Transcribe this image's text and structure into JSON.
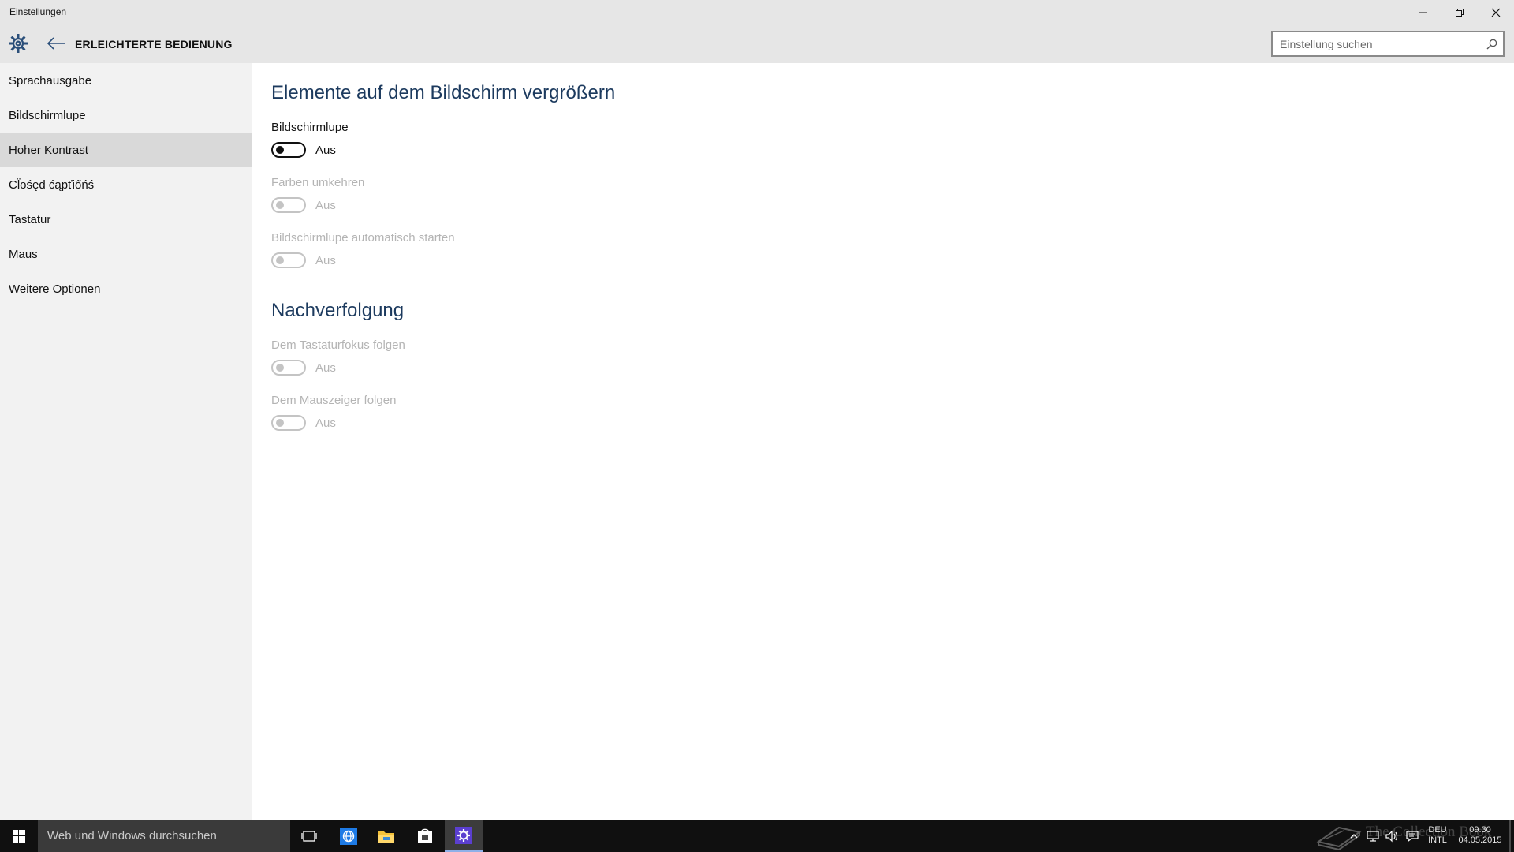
{
  "window": {
    "title": "Einstellungen",
    "section_title": "ERLEICHTERTE BEDIENUNG",
    "controls": {
      "minimize_icon": "minimize-icon",
      "restore_icon": "restore-icon",
      "close_icon": "close-icon"
    }
  },
  "search": {
    "placeholder": "Einstellung suchen",
    "value": ""
  },
  "sidebar": {
    "items": [
      {
        "label": "Sprachausgabe",
        "selected": false
      },
      {
        "label": "Bildschirmlupe",
        "selected": false
      },
      {
        "label": "Hoher Kontrast",
        "selected": true
      },
      {
        "label": "Cl̈ośęd ćąpťiőńś",
        "selected": false
      },
      {
        "label": "Tastatur",
        "selected": false
      },
      {
        "label": "Maus",
        "selected": false
      },
      {
        "label": "Weitere Optionen",
        "selected": false
      }
    ]
  },
  "main": {
    "group1": {
      "title": "Elemente auf dem Bildschirm vergrößern",
      "settings": [
        {
          "label": "Bildschirmlupe",
          "state": "Aus",
          "enabled": true,
          "on": false
        },
        {
          "label": "Farben umkehren",
          "state": "Aus",
          "enabled": false,
          "on": false
        },
        {
          "label": "Bildschirmlupe automatisch starten",
          "state": "Aus",
          "enabled": false,
          "on": false
        }
      ]
    },
    "group2": {
      "title": "Nachverfolgung",
      "settings": [
        {
          "label": "Dem Tastaturfokus folgen",
          "state": "Aus",
          "enabled": false,
          "on": false
        },
        {
          "label": "Dem Mauszeiger folgen",
          "state": "Aus",
          "enabled": false,
          "on": false
        }
      ]
    }
  },
  "taskbar": {
    "search_placeholder": "Web und Windows durchsuchen",
    "apps": [
      "task-view-icon",
      "edge-browser-icon",
      "file-explorer-icon",
      "store-icon",
      "settings-icon"
    ],
    "active_app": "settings-icon",
    "tray": {
      "language_top": "DEU",
      "language_bottom": "INTL",
      "time": "09:30",
      "date": "04.05.2015"
    },
    "watermark": "The Collection Book"
  },
  "colors": {
    "titlebar": "#e6e6e6",
    "sidebar": "#f2f2f2",
    "selected_nav": "#d9d9d9",
    "group_title": "#1c3a5e",
    "disabled_text": "#b4b4b4",
    "taskbar": "#101010",
    "settings_accent": "#5b3fd0"
  }
}
